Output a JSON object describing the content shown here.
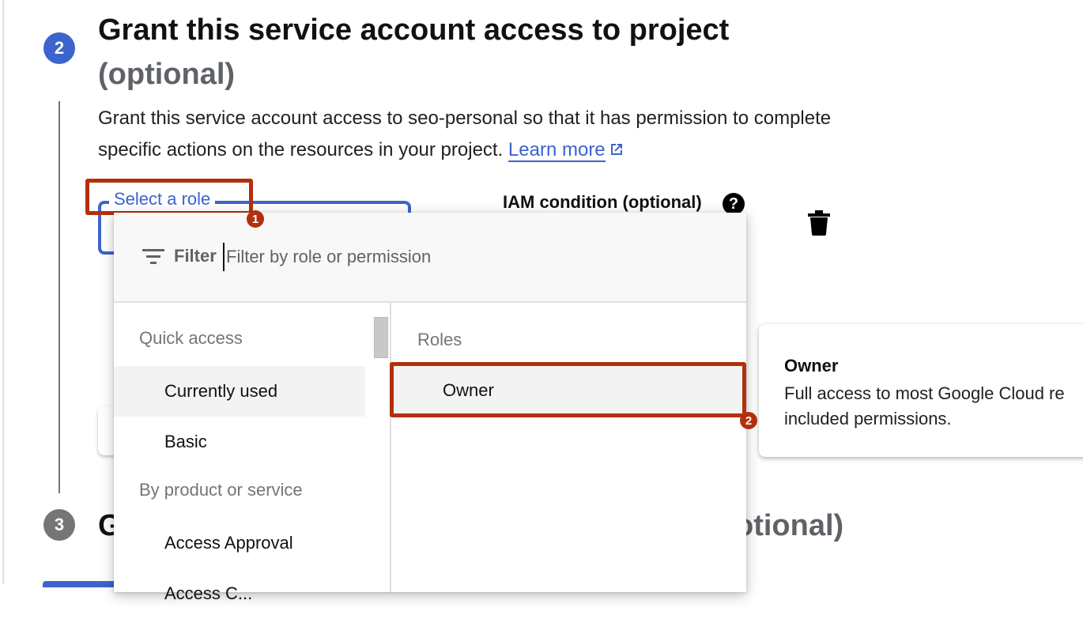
{
  "step2": {
    "number": "2",
    "title": "Grant this service account access to project",
    "title_optional": "(optional)",
    "description": "Grant this service account access to seo-personal so that it has permission to complete specific actions on the resources in your project. ",
    "learn_more": "Learn more"
  },
  "role_field": {
    "label": "Select a role"
  },
  "iam_condition": {
    "label": "IAM condition (optional)",
    "help_icon": "help-icon",
    "delete_icon": "trash-icon"
  },
  "annotations": {
    "first": "1",
    "second": "2"
  },
  "dropdown": {
    "filter_label": "Filter",
    "filter_placeholder": "Filter by role or permission",
    "filter_value": "",
    "left_pane": {
      "quick_access_header": "Quick access",
      "quick_access_items": [
        "Currently used",
        "Basic"
      ],
      "selected_item": "Currently used",
      "by_product_header": "By product or service",
      "product_items": [
        "Access Approval",
        "Access C..."
      ]
    },
    "right_pane": {
      "roles_header": "Roles",
      "roles": [
        "Owner"
      ]
    }
  },
  "tooltip": {
    "title": "Owner",
    "description_line1": "Full access to most Google Cloud re",
    "description_line2": "included permissions."
  },
  "step3": {
    "number": "3",
    "title_start": "G",
    "title_end": "otional)"
  },
  "colors": {
    "accent": "#3c64cc",
    "annotation": "#b3300c",
    "inactive_step": "#757575"
  }
}
